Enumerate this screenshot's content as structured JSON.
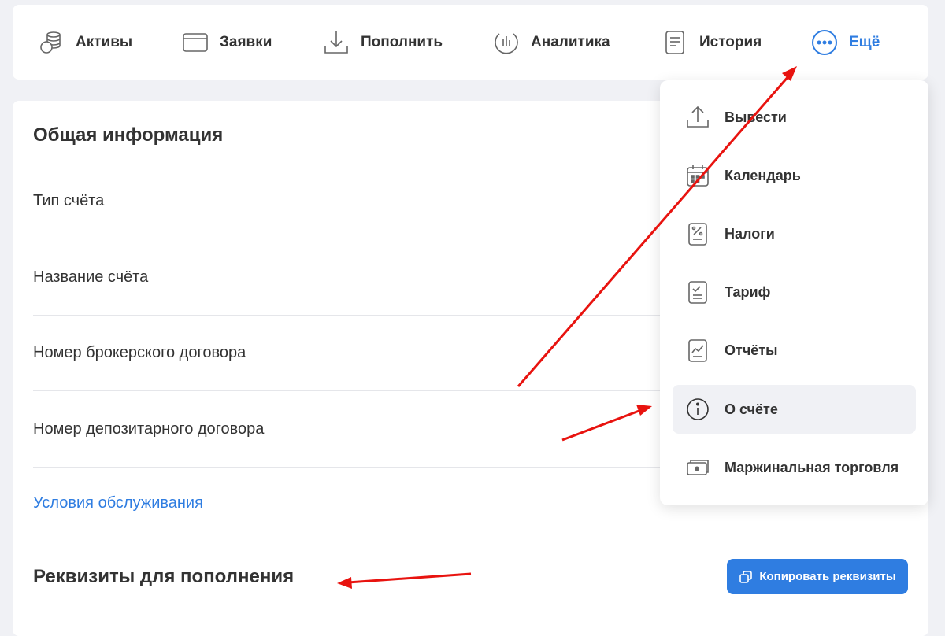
{
  "nav": {
    "items": [
      {
        "label": "Активы",
        "icon": "coins-icon"
      },
      {
        "label": "Заявки",
        "icon": "card-icon"
      },
      {
        "label": "Пополнить",
        "icon": "download-icon"
      },
      {
        "label": "Аналитика",
        "icon": "analytics-icon"
      },
      {
        "label": "История",
        "icon": "document-icon"
      },
      {
        "label": "Ещё",
        "icon": "more-icon"
      }
    ],
    "accent_color": "#2f7de1"
  },
  "general": {
    "title": "Общая информация",
    "rows": [
      "Тип счёта",
      "Название счёта",
      "Номер брокерского договора",
      "Номер депозитарного договора"
    ],
    "service_link": "Условия обслуживания"
  },
  "requisites": {
    "title": "Реквизиты для пополнения",
    "copy_button": "Копировать реквизиты"
  },
  "more_menu": {
    "items": [
      {
        "label": "Вывести",
        "icon": "upload-icon"
      },
      {
        "label": "Календарь",
        "icon": "calendar-icon"
      },
      {
        "label": "Налоги",
        "icon": "taxes-icon"
      },
      {
        "label": "Тариф",
        "icon": "tariff-icon"
      },
      {
        "label": "Отчёты",
        "icon": "reports-icon"
      },
      {
        "label": "О счёте",
        "icon": "info-icon",
        "active": true
      },
      {
        "label": "Маржинальная торговля",
        "icon": "cash-icon"
      }
    ]
  },
  "annotation_color": "#e8130f"
}
